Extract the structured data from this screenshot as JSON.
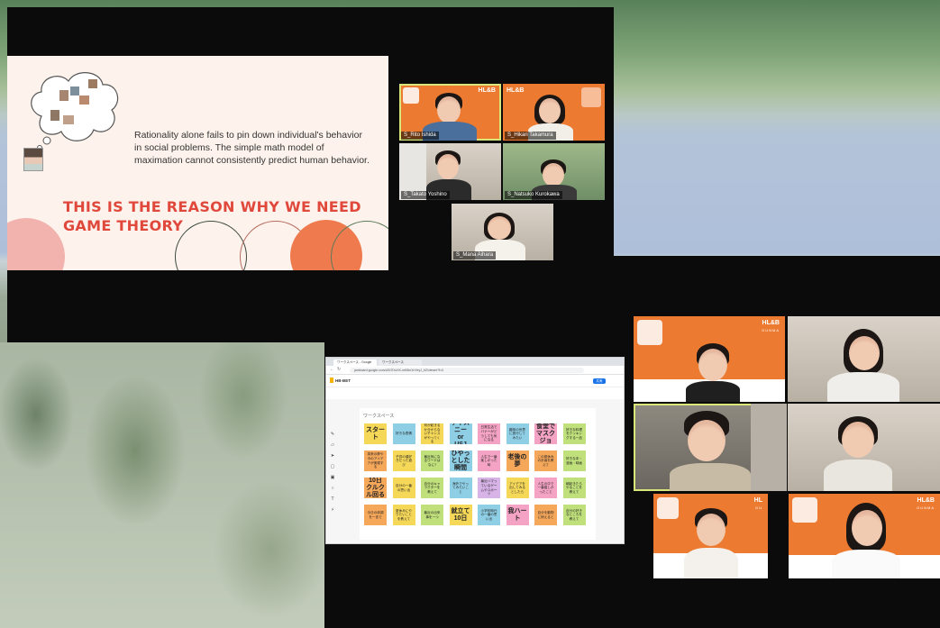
{
  "slide": {
    "body_text": "Rationality alone fails to pin down individual's behavior in social problems. The simple math model of maximation cannot consistently predict human behavior.",
    "headline_line1": "THIS IS THE REASON WHY WE NEED",
    "headline_line2": "GAME THEORY"
  },
  "meeting_top": {
    "participants": [
      {
        "name": "S_Rito Ishida",
        "logo": "HL&B"
      },
      {
        "name": "S_Hikari Takamura",
        "logo": "HL&B"
      },
      {
        "name": "S_Takato Yoshino"
      },
      {
        "name": "S_Natsuko Kurokawa"
      },
      {
        "name": "S_Mana Aihara"
      }
    ]
  },
  "meeting_bottom": {
    "logo": "HL&B",
    "logo_sub": "GUNMA",
    "logo_partial": "HL",
    "logo_partial_sub": "GU"
  },
  "browser": {
    "tab1": "ワークスペース - Google Jamboard",
    "tab2": "ワークスペース",
    "url": "jamboard.google.com/d/1t7lXzXK-mK8mXnYeyJ_bZ/viewer?f=0",
    "app_name": "HB-BET",
    "share_label": "共有",
    "board_title": "ワークスペース",
    "notes": [
      {
        "text": "スタート",
        "color": "yellow",
        "big": true
      },
      {
        "text": "好きな表情",
        "color": "blue"
      },
      {
        "text": "何が起きるか分からないチャンスがやってくる",
        "color": "yellow"
      },
      {
        "text": "ディズニー or USJ",
        "color": "blue",
        "big": true
      },
      {
        "text": "日常生活でバナーがどうしても気になる",
        "color": "pink"
      },
      {
        "text": "趣味の世界に旅行してみたい",
        "color": "blue"
      },
      {
        "text": "食堂でマスクジョ",
        "color": "pink",
        "big": true
      },
      {
        "text": "好きな料理をクッキングする一品",
        "color": "green"
      },
      {
        "text": "将来の夢や今のアイデアが実現する",
        "color": "orange"
      },
      {
        "text": "子供の頃好きだった遊び",
        "color": "yellow"
      },
      {
        "text": "最近気になるワードはなに?",
        "color": "green"
      },
      {
        "text": "ひやっとした瞬間",
        "color": "blue",
        "big": true
      },
      {
        "text": "人生で一番楽しかった時",
        "color": "pink"
      },
      {
        "text": "老後の夢",
        "color": "orange",
        "big": true
      },
      {
        "text": "この夏休みの計画を教えて",
        "color": "orange"
      },
      {
        "text": "好きな本・漫画・映画",
        "color": "green"
      },
      {
        "text": "10日クルクル回る",
        "color": "orange",
        "big": true
      },
      {
        "text": "自分の一番の思い出",
        "color": "yellow"
      },
      {
        "text": "自分のキャラクターを教えて",
        "color": "green"
      },
      {
        "text": "海外でやってみたいこと",
        "color": "blue"
      },
      {
        "text": "最近ハマっているゲームやスポーツ",
        "color": "lilac"
      },
      {
        "text": "アイデアを出してみるとしたら",
        "color": "yellow"
      },
      {
        "text": "人生の中で一番嬉しかったこと",
        "color": "pink"
      },
      {
        "text": "朝起きたらやることを教えて",
        "color": "green"
      },
      {
        "text": "今日の体調を一言で",
        "color": "orange"
      },
      {
        "text": "夏休みにやりたいことを教えて",
        "color": "yellow"
      },
      {
        "text": "最近の出来事を一つ",
        "color": "green"
      },
      {
        "text": "就立て10日",
        "color": "yellow",
        "big": true
      },
      {
        "text": "小学校時代の一番の思い出",
        "color": "blue"
      },
      {
        "text": "我ハート",
        "color": "pink",
        "big": true
      },
      {
        "text": "自分を動物に例えると",
        "color": "orange"
      },
      {
        "text": "自分の好きなところを教えて",
        "color": "green"
      }
    ]
  }
}
